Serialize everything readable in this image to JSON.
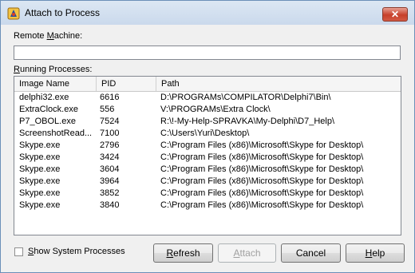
{
  "window": {
    "title": "Attach to Process",
    "close_glyph": "✕",
    "icon": "delphi-app-icon"
  },
  "remote_machine": {
    "label_pre": "Remote ",
    "label_u": "M",
    "label_post": "achine:",
    "value": ""
  },
  "processes": {
    "label_u": "R",
    "label_post": "unning Processes:",
    "columns": [
      "Image Name",
      "PID",
      "Path"
    ],
    "rows": [
      [
        "delphi32.exe",
        "6616",
        "D:\\PROGRAMs\\COMPILATOR\\Delphi7\\Bin\\"
      ],
      [
        "ExtraClock.exe",
        "556",
        "V:\\PROGRAMs\\Extra Clock\\"
      ],
      [
        "P7_OBOL.exe",
        "7524",
        "R:\\!-My-Help-SPRAVKA\\My-Delphi\\D7_Help\\"
      ],
      [
        "ScreenshotRead...",
        "7100",
        "C:\\Users\\Yuri\\Desktop\\"
      ],
      [
        "Skype.exe",
        "2796",
        "C:\\Program Files (x86)\\Microsoft\\Skype for Desktop\\"
      ],
      [
        "Skype.exe",
        "3424",
        "C:\\Program Files (x86)\\Microsoft\\Skype for Desktop\\"
      ],
      [
        "Skype.exe",
        "3604",
        "C:\\Program Files (x86)\\Microsoft\\Skype for Desktop\\"
      ],
      [
        "Skype.exe",
        "3964",
        "C:\\Program Files (x86)\\Microsoft\\Skype for Desktop\\"
      ],
      [
        "Skype.exe",
        "3852",
        "C:\\Program Files (x86)\\Microsoft\\Skype for Desktop\\"
      ],
      [
        "Skype.exe",
        "3840",
        "C:\\Program Files (x86)\\Microsoft\\Skype for Desktop\\"
      ]
    ]
  },
  "show_system": {
    "label_u": "S",
    "label_post": "how System Processes",
    "checked": false
  },
  "buttons": {
    "refresh_u": "R",
    "refresh_post": "efresh",
    "attach_u": "A",
    "attach_post": "ttach",
    "cancel": "Cancel",
    "help_u": "H",
    "help_post": "elp"
  }
}
